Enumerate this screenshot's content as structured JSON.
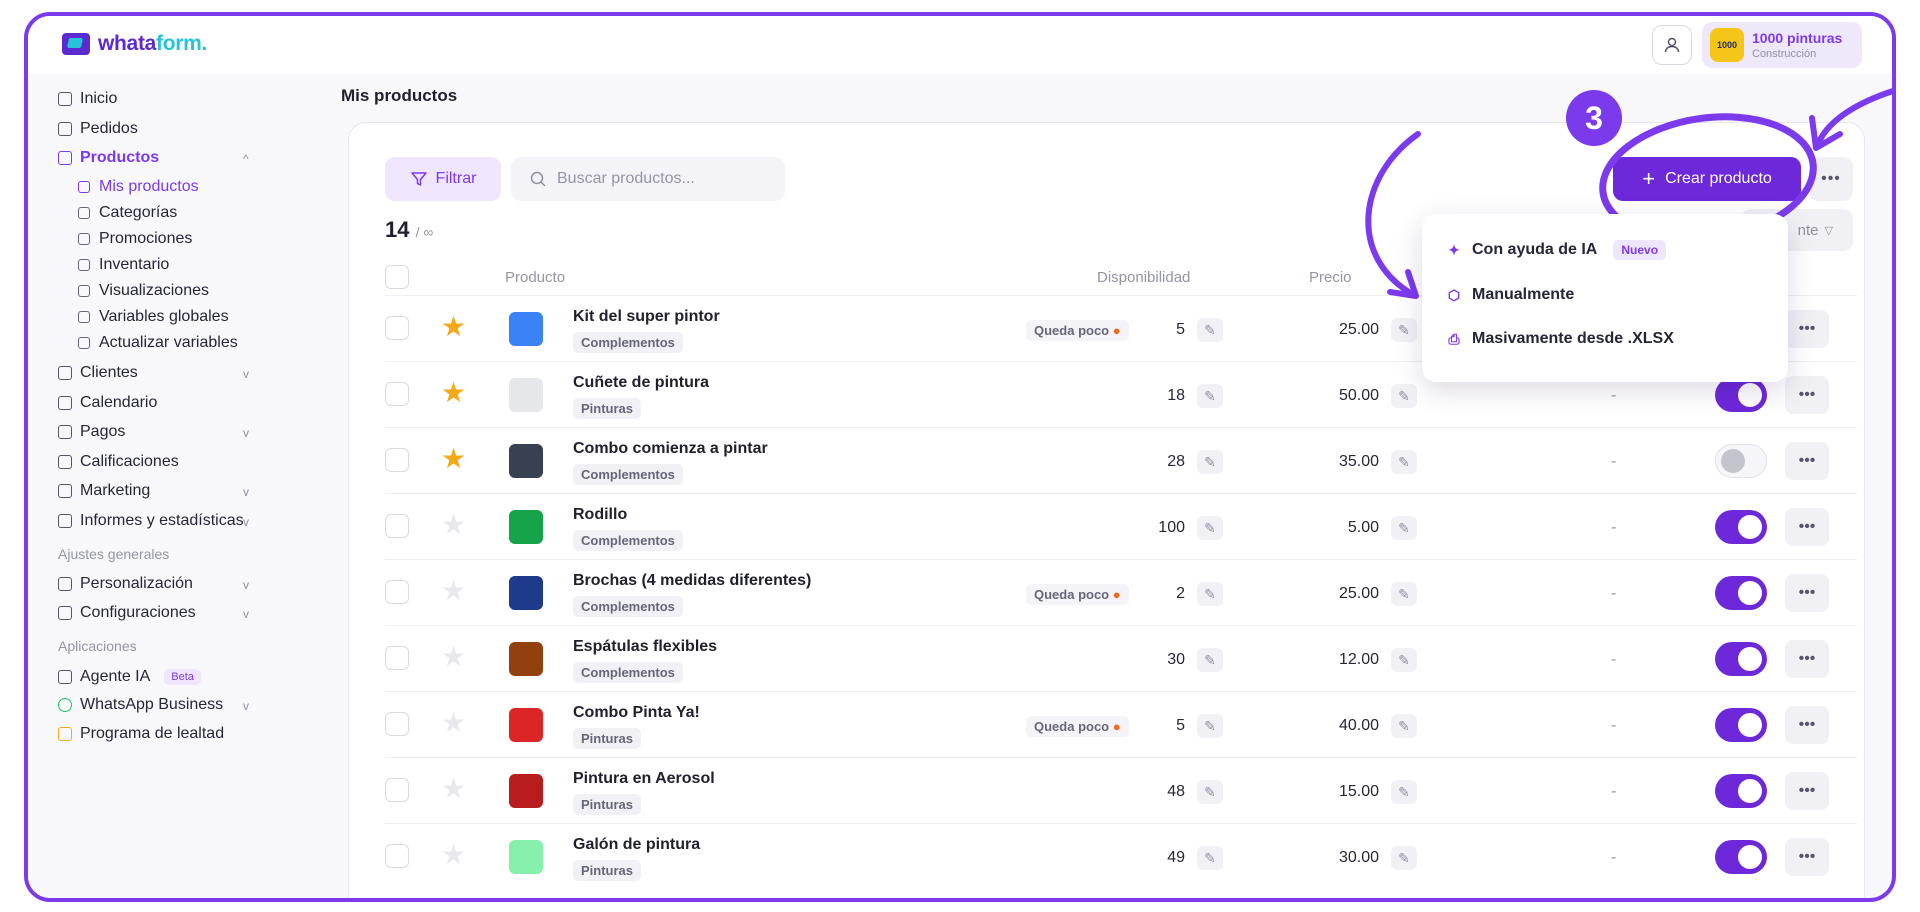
{
  "brand": {
    "name_part1": "whata",
    "name_part2": "form."
  },
  "store": {
    "name": "1000 pinturas",
    "category": "Construcción",
    "avatar_text": "1000"
  },
  "sidebar": {
    "items": [
      {
        "label": "Inicio"
      },
      {
        "label": "Pedidos"
      },
      {
        "label": "Productos"
      },
      {
        "label": "Clientes"
      },
      {
        "label": "Calendario"
      },
      {
        "label": "Pagos"
      },
      {
        "label": "Calificaciones"
      },
      {
        "label": "Marketing"
      },
      {
        "label": "Informes y estadísticas"
      }
    ],
    "products_sub": [
      {
        "label": "Mis productos"
      },
      {
        "label": "Categorías"
      },
      {
        "label": "Promociones"
      },
      {
        "label": "Inventario"
      },
      {
        "label": "Visualizaciones"
      },
      {
        "label": "Variables globales"
      },
      {
        "label": "Actualizar variables"
      }
    ],
    "section_general": "Ajustes generales",
    "general": [
      {
        "label": "Personalización"
      },
      {
        "label": "Configuraciones"
      }
    ],
    "section_apps": "Aplicaciones",
    "apps": [
      {
        "label": "Agente IA",
        "badge": "Beta"
      },
      {
        "label": "WhatsApp Business"
      },
      {
        "label": "Programa de lealtad"
      }
    ]
  },
  "page": {
    "title": "Mis productos"
  },
  "toolbar": {
    "filter_label": "Filtrar",
    "search_placeholder": "Buscar productos...",
    "count": "14",
    "limit": "/ ∞",
    "create_label": "Crear producto",
    "sort_label": "nte"
  },
  "table": {
    "headers": {
      "product": "Producto",
      "availability": "Disponibilidad",
      "price": "Precio"
    },
    "low_stock_label": "Queda poco",
    "rows": [
      {
        "name": "Kit del super pintor",
        "category": "Complementos",
        "stock": "5",
        "price": "25.00",
        "starred": true,
        "low": true,
        "active": null,
        "color": "#3b82f6"
      },
      {
        "name": "Cuñete de pintura",
        "category": "Pinturas",
        "stock": "18",
        "price": "50.00",
        "starred": true,
        "low": false,
        "active": true,
        "dash": "-",
        "color": "#e5e7eb"
      },
      {
        "name": "Combo comienza a pintar",
        "category": "Complementos",
        "stock": "28",
        "price": "35.00",
        "starred": true,
        "low": false,
        "active": false,
        "dash": "-",
        "color": "#374151"
      },
      {
        "name": "Rodillo",
        "category": "Complementos",
        "stock": "100",
        "price": "5.00",
        "starred": false,
        "low": false,
        "active": true,
        "dash": "-",
        "color": "#16a34a"
      },
      {
        "name": "Brochas (4 medidas diferentes)",
        "category": "Complementos",
        "stock": "2",
        "price": "25.00",
        "starred": false,
        "low": true,
        "active": true,
        "dash": "-",
        "color": "#1e3a8a"
      },
      {
        "name": "Espátulas flexibles",
        "category": "Complementos",
        "stock": "30",
        "price": "12.00",
        "starred": false,
        "low": false,
        "active": true,
        "dash": "-",
        "color": "#92400e"
      },
      {
        "name": "Combo Pinta Ya!",
        "category": "Pinturas",
        "stock": "5",
        "price": "40.00",
        "starred": false,
        "low": true,
        "active": true,
        "dash": "-",
        "color": "#dc2626"
      },
      {
        "name": "Pintura en Aerosol",
        "category": "Pinturas",
        "stock": "48",
        "price": "15.00",
        "starred": false,
        "low": false,
        "active": true,
        "dash": "-",
        "color": "#b91c1c"
      },
      {
        "name": "Galón de pintura",
        "category": "Pinturas",
        "stock": "49",
        "price": "30.00",
        "starred": false,
        "low": false,
        "active": true,
        "dash": "-",
        "color": "#86efac"
      }
    ]
  },
  "create_menu": {
    "items": [
      {
        "label": "Con ayuda de IA",
        "badge": "Nuevo",
        "icon": "sparkle-icon"
      },
      {
        "label": "Manualmente",
        "icon": "cube-icon"
      },
      {
        "label": "Masivamente desde .XLSX",
        "icon": "file-upload-icon"
      }
    ]
  },
  "annotation": {
    "step": "3"
  },
  "colors": {
    "accent": "#7c3aed",
    "button": "#6d28d9",
    "star": "#f4a916"
  }
}
